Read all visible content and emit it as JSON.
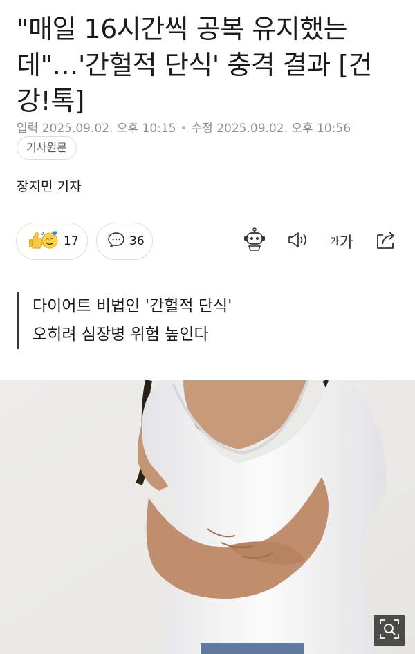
{
  "article": {
    "headline": "\"매일 16시간씩 공복 유지했는데\"…'간헐적 단식' 충격 결과 [건강!톡]",
    "published": "입력 2025.09.02. 오후 10:15",
    "modified": "수정 2025.09.02. 오후 10:56",
    "original_button": "기사원문",
    "reporter": "장지민 기자"
  },
  "actions": {
    "reaction_count": "17",
    "comment_count": "36",
    "font_small_glyph": "가",
    "font_big_glyph": "가"
  },
  "icons": {
    "reaction": "thumbs-up-and-smile-emoji-icon",
    "comment": "speech-bubble-icon",
    "bot": "robot-icon",
    "sound": "speaker-icon",
    "share": "share-icon",
    "zoom": "magnifier-zoom-icon"
  },
  "subheadline": {
    "line1": "다이어트 비법인 '간헐적 단식'",
    "line2": "오히려 심장병 위험 높인다"
  }
}
